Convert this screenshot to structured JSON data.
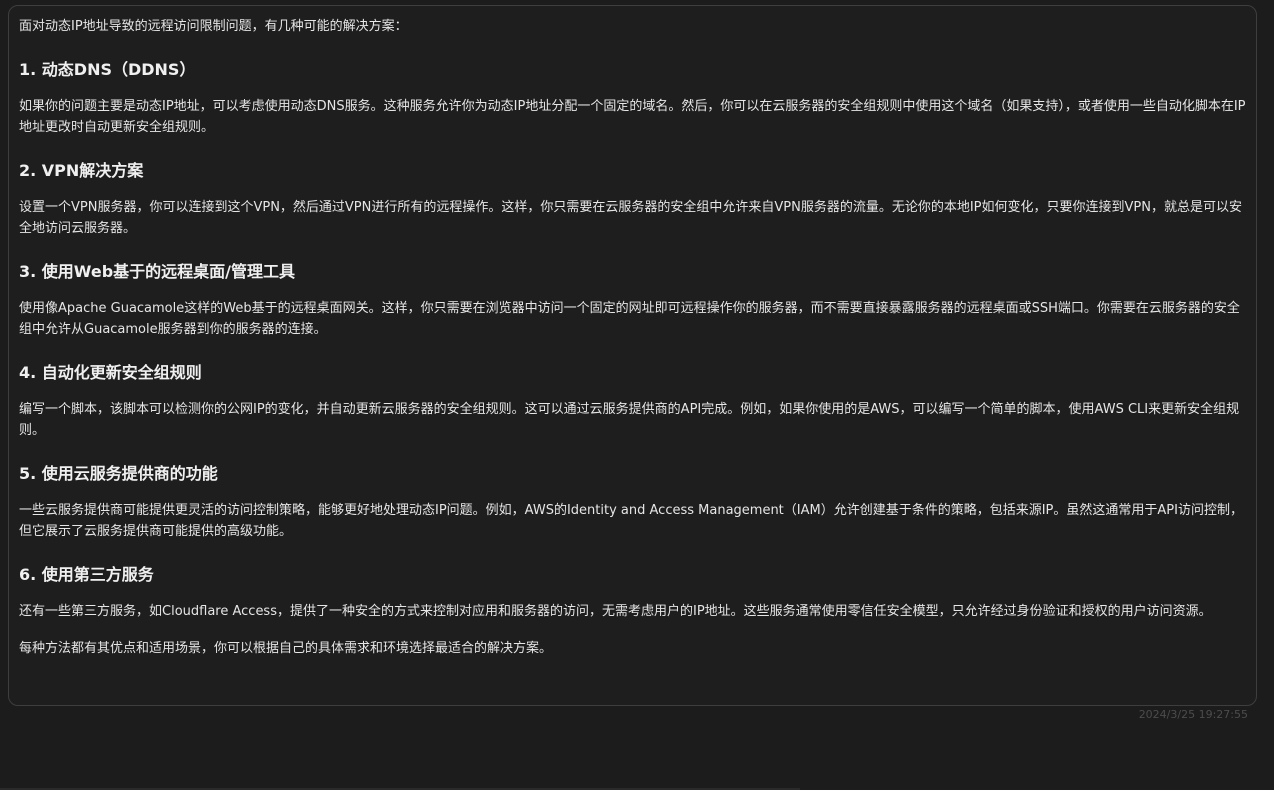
{
  "message": {
    "intro": "面对动态IP地址导致的远程访问限制问题，有几种可能的解决方案：",
    "sections": [
      {
        "heading": "1. 动态DNS（DDNS）",
        "body": "如果你的问题主要是动态IP地址，可以考虑使用动态DNS服务。这种服务允许你为动态IP地址分配一个固定的域名。然后，你可以在云服务器的安全组规则中使用这个域名（如果支持），或者使用一些自动化脚本在IP地址更改时自动更新安全组规则。"
      },
      {
        "heading": "2. VPN解决方案",
        "body": "设置一个VPN服务器，你可以连接到这个VPN，然后通过VPN进行所有的远程操作。这样，你只需要在云服务器的安全组中允许来自VPN服务器的流量。无论你的本地IP如何变化，只要你连接到VPN，就总是可以安全地访问云服务器。"
      },
      {
        "heading": "3. 使用Web基于的远程桌面/管理工具",
        "body": "使用像Apache Guacamole这样的Web基于的远程桌面网关。这样，你只需要在浏览器中访问一个固定的网址即可远程操作你的服务器，而不需要直接暴露服务器的远程桌面或SSH端口。你需要在云服务器的安全组中允许从Guacamole服务器到你的服务器的连接。"
      },
      {
        "heading": "4. 自动化更新安全组规则",
        "body": "编写一个脚本，该脚本可以检测你的公网IP的变化，并自动更新云服务器的安全组规则。这可以通过云服务提供商的API完成。例如，如果你使用的是AWS，可以编写一个简单的脚本，使用AWS CLI来更新安全组规则。"
      },
      {
        "heading": "5. 使用云服务提供商的功能",
        "body": "一些云服务提供商可能提供更灵活的访问控制策略，能够更好地处理动态IP问题。例如，AWS的Identity and Access Management（IAM）允许创建基于条件的策略，包括来源IP。虽然这通常用于API访问控制，但它展示了云服务提供商可能提供的高级功能。"
      },
      {
        "heading": "6. 使用第三方服务",
        "body": "还有一些第三方服务，如Cloudflare Access，提供了一种安全的方式来控制对应用和服务器的访问，无需考虑用户的IP地址。这些服务通常使用零信任安全模型，只允许经过身份验证和授权的用户访问资源。"
      }
    ],
    "closing": "每种方法都有其优点和适用场景，你可以根据自己的具体需求和环境选择最适合的解决方案。",
    "timestamp": "2024/3/25 19:27:55"
  }
}
